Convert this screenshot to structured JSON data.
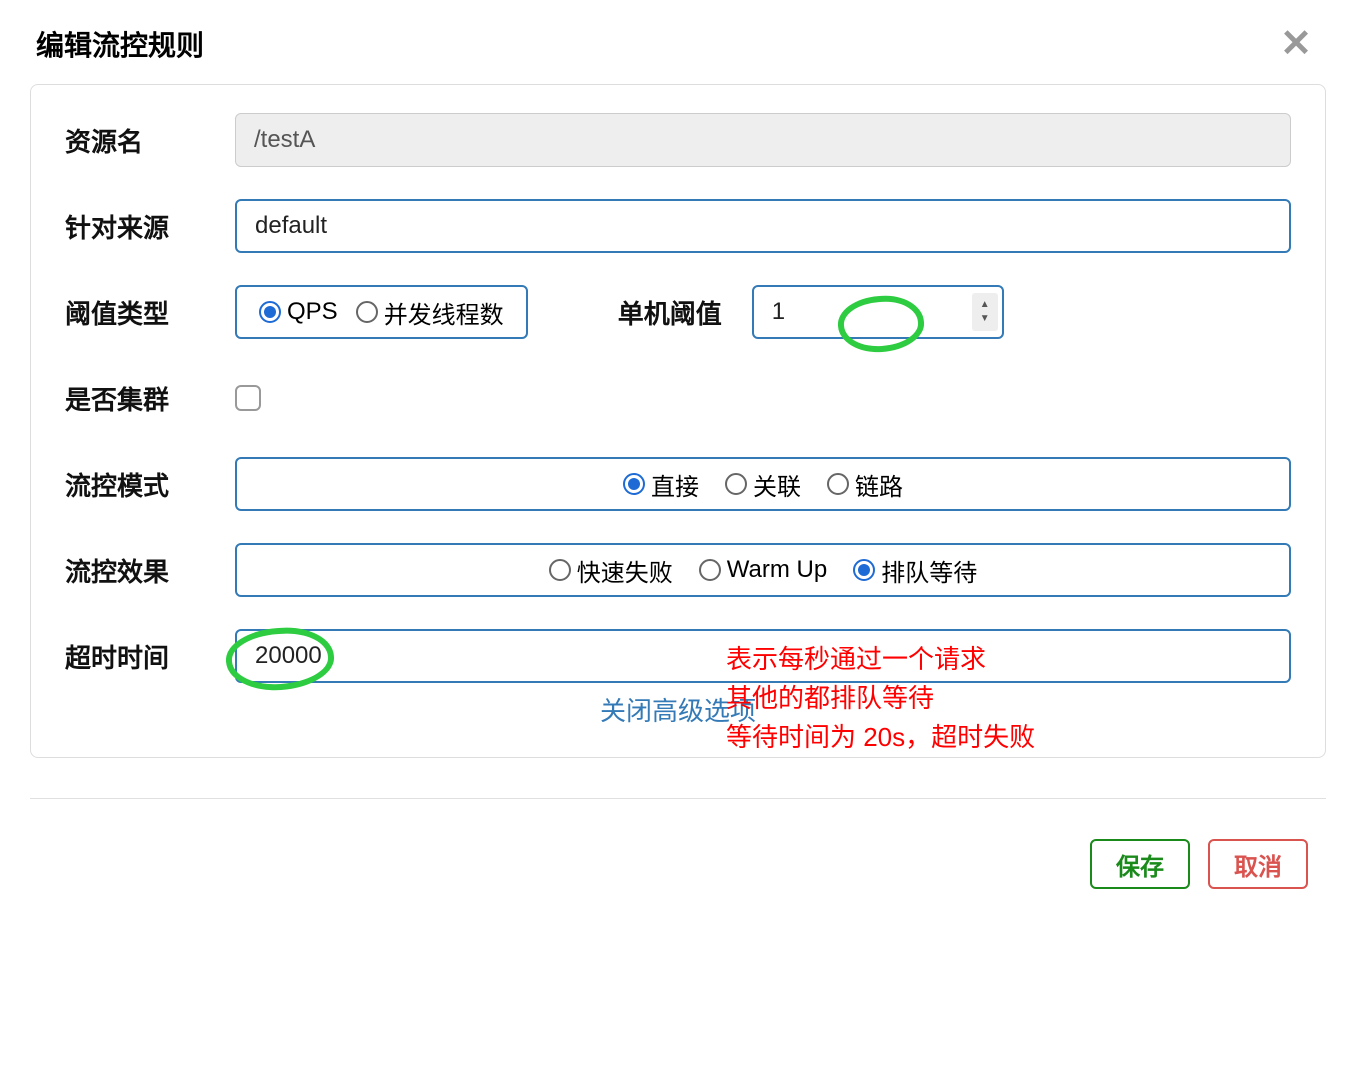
{
  "modal": {
    "title": "编辑流控规则",
    "close_advanced_label": "关闭高级选项"
  },
  "fields": {
    "resource_name": {
      "label": "资源名",
      "value": "/testA"
    },
    "limit_app": {
      "label": "针对来源",
      "value": "default"
    },
    "threshold_type": {
      "label": "阈值类型",
      "options": {
        "qps": "QPS",
        "thread": "并发线程数"
      },
      "selected": "qps"
    },
    "single_threshold": {
      "label": "单机阈值",
      "value": "1"
    },
    "cluster": {
      "label": "是否集群",
      "checked": false
    },
    "flow_mode": {
      "label": "流控模式",
      "options": {
        "direct": "直接",
        "relate": "关联",
        "chain": "链路"
      },
      "selected": "direct"
    },
    "flow_effect": {
      "label": "流控效果",
      "options": {
        "fail_fast": "快速失败",
        "warm_up": "Warm Up",
        "queue": "排队等待"
      },
      "selected": "queue"
    },
    "timeout": {
      "label": "超时时间",
      "value": "20000"
    }
  },
  "footer": {
    "save": "保存",
    "cancel": "取消"
  },
  "annotation": {
    "line1": "表示每秒通过一个请求",
    "line2": "其他的都排队等待",
    "line3": "等待时间为 20s，超时失败"
  }
}
